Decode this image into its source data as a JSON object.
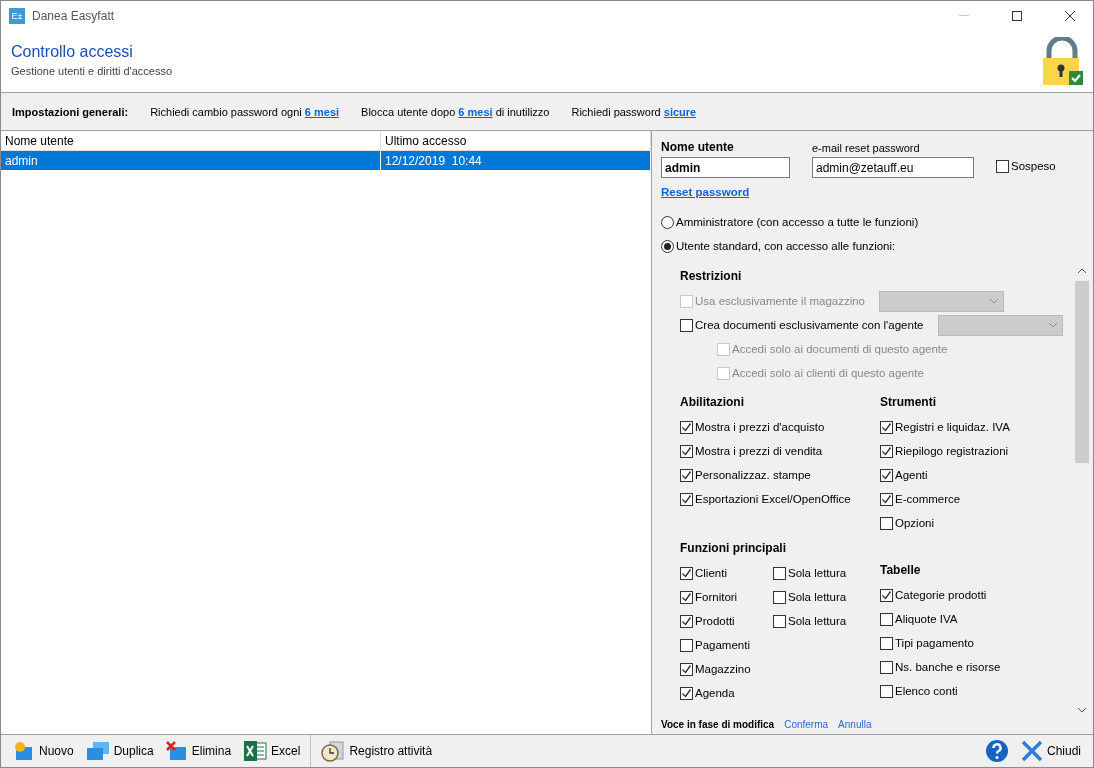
{
  "window": {
    "title": "Danea Easyfatt",
    "app_icon": "E±"
  },
  "header": {
    "title": "Controllo accessi",
    "subtitle": "Gestione utenti e diritti d'accesso"
  },
  "settings": {
    "label": "Impostazioni generali:",
    "items": [
      {
        "before": "Richiedi cambio password ogni",
        "link": "6 mesi"
      },
      {
        "before": "Blocca utente dopo",
        "link": "6 mesi",
        "after": "di inutilizzo"
      },
      {
        "before": "Richiedi password",
        "link": "sicure"
      }
    ]
  },
  "table": {
    "columns": [
      "Nome utente",
      "Ultimo accesso"
    ],
    "rows": [
      {
        "cells": [
          "admin",
          "12/12/2019  10:44"
        ],
        "selected": true
      }
    ]
  },
  "form": {
    "username_label": "Nome utente",
    "username": "admin",
    "email_label": "e-mail reset password",
    "email": "admin@zetauff.eu",
    "suspended": {
      "label": "Sospeso",
      "checked": false
    },
    "reset_link": "Reset password",
    "roles": [
      {
        "label": "Amministratore (con accesso a tutte le funzioni)",
        "selected": false
      },
      {
        "label": "Utente standard, con accesso alle funzioni:",
        "selected": true
      }
    ]
  },
  "restrictions": {
    "title": "Restrizioni",
    "items": [
      {
        "kind": "dropdown",
        "label": "Usa esclusivamente il magazzino",
        "checked": false,
        "disabled": true
      },
      {
        "kind": "dropdown",
        "label": "Crea documenti esclusivamente con l'agente",
        "checked": false,
        "disabled": false
      },
      {
        "kind": "sub",
        "label": "Accedi solo ai documenti di questo agente",
        "checked": false,
        "disabled": true
      },
      {
        "kind": "sub",
        "label": "Accedi solo ai clienti di questo agente",
        "checked": false,
        "disabled": true
      }
    ]
  },
  "abilitazioni": {
    "title": "Abilitazioni",
    "items": [
      {
        "label": "Mostra i prezzi d'acquisto",
        "checked": true
      },
      {
        "label": "Mostra i prezzi di vendita",
        "checked": true
      },
      {
        "label": "Personalizzaz. stampe",
        "checked": true
      },
      {
        "label": "Esportazioni Excel/OpenOffice",
        "checked": true
      }
    ]
  },
  "strumenti": {
    "title": "Strumenti",
    "items": [
      {
        "label": "Registri e liquidaz. IVA",
        "checked": true
      },
      {
        "label": "Riepilogo registrazioni",
        "checked": true
      },
      {
        "label": "Agenti",
        "checked": true
      },
      {
        "label": "E-commerce",
        "checked": true
      },
      {
        "label": "Opzioni",
        "checked": false
      }
    ]
  },
  "funzioni": {
    "title": "Funzioni principali",
    "items": [
      {
        "label": "Clienti",
        "checked": true,
        "readonly": {
          "label": "Sola lettura",
          "checked": false
        }
      },
      {
        "label": "Fornitori",
        "checked": true,
        "readonly": {
          "label": "Sola lettura",
          "checked": false
        }
      },
      {
        "label": "Prodotti",
        "checked": true,
        "readonly": {
          "label": "Sola lettura",
          "checked": false
        }
      },
      {
        "label": "Pagamenti",
        "checked": false
      },
      {
        "label": "Magazzino",
        "checked": true
      },
      {
        "label": "Agenda",
        "checked": true
      }
    ]
  },
  "tabelle": {
    "title": "Tabelle",
    "items": [
      {
        "label": "Categorie prodotti",
        "checked": true
      },
      {
        "label": "Aliquote IVA",
        "checked": false
      },
      {
        "label": "Tipi pagamento",
        "checked": false
      },
      {
        "label": "Ns. banche e risorse",
        "checked": false
      },
      {
        "label": "Elenco conti",
        "checked": false
      }
    ]
  },
  "edit_footer": {
    "label": "Voce in fase di modifica",
    "confirm": "Conferma",
    "cancel": "Annulla"
  },
  "toolbar": {
    "left": [
      {
        "kind": "new",
        "label": "Nuovo"
      },
      {
        "kind": "duplicate",
        "label": "Duplica"
      },
      {
        "kind": "delete",
        "label": "Elimina"
      },
      {
        "kind": "excel",
        "label": "Excel"
      },
      {
        "kind": "log",
        "label": "Registro attività"
      }
    ],
    "right": [
      {
        "kind": "help"
      },
      {
        "kind": "close",
        "label": "Chiudi"
      }
    ]
  }
}
